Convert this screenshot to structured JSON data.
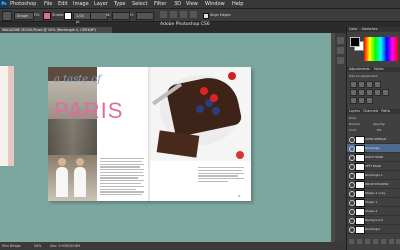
{
  "menubar": {
    "app_name": "Photoshop",
    "items": [
      "File",
      "Edit",
      "Image",
      "Layer",
      "Type",
      "Select",
      "Filter",
      "3D",
      "View",
      "Window",
      "Help"
    ]
  },
  "options": {
    "shape_mode": "Shape",
    "fill_label": "Fill:",
    "stroke_label": "Stroke:",
    "stroke_size": "1.00 pt",
    "w_label": "W:",
    "h_label": "H:",
    "align_edges": "Align Edges"
  },
  "app_title": "Adobe Photoshop CS6",
  "document_tab": "MAGAZINE MOCKUP.psd @ 50% (Rectangle 4, CMYK/8*)",
  "spread": {
    "script_title": "a taste of",
    "big_title": "PARIS",
    "page_number": "2."
  },
  "status": {
    "zoom": "50%",
    "doc_size": "Doc: 9.93M/43.6M",
    "mini_bridge": "Mini Bridge"
  },
  "panels": {
    "color_tab": "Color",
    "swatches_tab": "Swatches",
    "adjustments_tab": "Adjustments",
    "styles_tab": "Styles",
    "add_adjustment": "Add an adjustment",
    "layers_tab": "Layers",
    "channels_tab": "Channels",
    "paths_tab": "Paths",
    "kind_label": "Kind",
    "blend_mode": "Normal",
    "lock_label": "Lock:",
    "opacity_label": "Opacity:",
    "fill_label": "Fill:",
    "layers": [
      {
        "name": "OPEN SPREAD",
        "selected": false
      },
      {
        "name": "Rectangle",
        "selected": true
      },
      {
        "name": "RIGHT PAGE",
        "selected": false
      },
      {
        "name": "LEFT PAGE",
        "selected": false
      },
      {
        "name": "Rectangle 1",
        "selected": false
      },
      {
        "name": "DROP SHADOW",
        "selected": false
      },
      {
        "name": "Shape 1 copy",
        "selected": false
      },
      {
        "name": "Shape 1",
        "selected": false
      },
      {
        "name": "Shape 2",
        "selected": false
      },
      {
        "name": "Background",
        "selected": false
      },
      {
        "name": "Rectangle",
        "selected": false
      }
    ]
  },
  "colors": {
    "canvas_bg": "#7ca6a0",
    "title_pink": "#e06ba0",
    "title_blue": "#7aa0c4"
  }
}
